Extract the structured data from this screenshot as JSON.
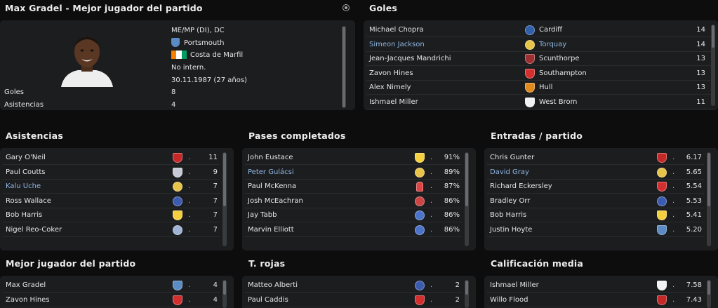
{
  "player_panel": {
    "title": "Max Gradel - Mejor jugador del partido",
    "position": "ME/MP (DI), DC",
    "club": "Portsmouth",
    "nationality": "Costa de Marfil",
    "intl_status": "No intern.",
    "dob": "30.11.1987 (27 años)",
    "stats": [
      {
        "label": "Goles",
        "value": "8"
      },
      {
        "label": "Asistencias",
        "value": "4"
      }
    ]
  },
  "goals_panel": {
    "title": "Goles",
    "rows": [
      {
        "name": "Michael Chopra",
        "club": "Cardiff",
        "value": "14",
        "badge": "cardiff",
        "highlight": false
      },
      {
        "name": "Simeon Jackson",
        "club": "Torquay",
        "value": "14",
        "badge": "torquay",
        "highlight": true
      },
      {
        "name": "Jean-Jacques Mandrichi",
        "club": "Scunthorpe",
        "value": "13",
        "badge": "scunthorpe",
        "highlight": false
      },
      {
        "name": "Zavon Hines",
        "club": "Southampton",
        "value": "13",
        "badge": "southampton",
        "highlight": false
      },
      {
        "name": "Alex Nimely",
        "club": "Hull",
        "value": "13",
        "badge": "hull",
        "highlight": false
      },
      {
        "name": "Ishmael Miller",
        "club": "West Brom",
        "value": "11",
        "badge": "westbrom",
        "highlight": false
      }
    ]
  },
  "assists_panel": {
    "title": "Asistencias",
    "rows": [
      {
        "name": "Gary O'Neil",
        "value": "11",
        "badge": "middlesbrough",
        "highlight": false
      },
      {
        "name": "Paul Coutts",
        "value": "9",
        "badge": "sheffield",
        "highlight": false
      },
      {
        "name": "Kalu Uche",
        "value": "7",
        "badge": "torquay",
        "highlight": true
      },
      {
        "name": "Ross Wallace",
        "value": "7",
        "badge": "qpr",
        "highlight": false
      },
      {
        "name": "Bob Harris",
        "value": "7",
        "badge": "watford",
        "highlight": false
      },
      {
        "name": "Nigel Reo-Coker",
        "value": "7",
        "badge": "millwall",
        "highlight": false
      }
    ]
  },
  "passes_panel": {
    "title": "Pases completados",
    "rows": [
      {
        "name": "John Eustace",
        "value": "91%",
        "badge": "watford",
        "highlight": false
      },
      {
        "name": "Peter Gulácsi",
        "value": "89%",
        "badge": "torquay",
        "highlight": true
      },
      {
        "name": "Paul McKenna",
        "value": "87%",
        "badge": "bottle",
        "highlight": false
      },
      {
        "name": "Josh McEachran",
        "value": "86%",
        "badge": "palace",
        "highlight": false
      },
      {
        "name": "Jay Tabb",
        "value": "86%",
        "badge": "reading",
        "highlight": false
      },
      {
        "name": "Marvin Elliott",
        "value": "86%",
        "badge": "reading",
        "highlight": false
      }
    ]
  },
  "tackles_panel": {
    "title": "Entradas / partido",
    "rows": [
      {
        "name": "Chris Gunter",
        "value": "6.17",
        "badge": "middlesbrough",
        "highlight": false
      },
      {
        "name": "David Gray",
        "value": "5.65",
        "badge": "torquay",
        "highlight": true
      },
      {
        "name": "Richard Eckersley",
        "value": "5.54",
        "badge": "southampton",
        "highlight": false
      },
      {
        "name": "Bradley Orr",
        "value": "5.53",
        "badge": "qpr",
        "highlight": false
      },
      {
        "name": "Bob Harris",
        "value": "5.41",
        "badge": "watford",
        "highlight": false
      },
      {
        "name": "Justin Hoyte",
        "value": "5.20",
        "badge": "portsmouth",
        "highlight": false
      }
    ]
  },
  "motm_panel": {
    "title": "Mejor jugador del partido",
    "rows": [
      {
        "name": "Max Gradel",
        "value": "4",
        "badge": "portsmouth",
        "highlight": false
      },
      {
        "name": "Zavon Hines",
        "value": "4",
        "badge": "southampton",
        "highlight": false
      }
    ]
  },
  "red_panel": {
    "title": "T. rojas",
    "rows": [
      {
        "name": "Matteo Alberti",
        "value": "2",
        "badge": "qpr",
        "highlight": false
      },
      {
        "name": "Paul Caddis",
        "value": "2",
        "badge": "southampton",
        "highlight": false
      }
    ]
  },
  "rating_panel": {
    "title": "Calificación media",
    "rows": [
      {
        "name": "Ishmael Miller",
        "value": "7.58",
        "badge": "westbrom",
        "highlight": false
      },
      {
        "name": "Willo Flood",
        "value": "7.43",
        "badge": "middlesbrough",
        "highlight": false
      }
    ]
  },
  "colors": {
    "panel": "#1c1d1f",
    "highlight_text": "#8fb6e2",
    "ivory_coast_orange": "#f77f00",
    "ivory_coast_green": "#009e60"
  }
}
